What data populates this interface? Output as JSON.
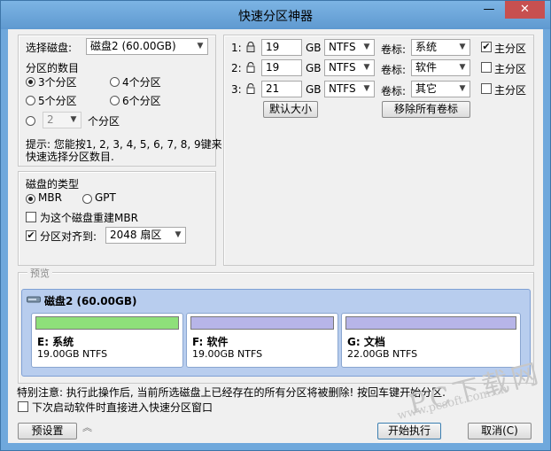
{
  "window": {
    "title": "快速分区神器",
    "minimize": "—",
    "close": "✕"
  },
  "disk": {
    "select_label": "选择磁盘:",
    "selected_disk": "磁盘2 (60.00GB)",
    "count_label": "分区的数目",
    "options": [
      "3个分区",
      "4个分区",
      "5个分区",
      "6个分区"
    ],
    "custom_value": "2",
    "custom_suffix": "个分区",
    "hint_line1": "提示: 您能按1, 2, 3, 4, 5, 6, 7, 8, 9键来",
    "hint_line2": "快速选择分区数目."
  },
  "disk_type": {
    "label": "磁盘的类型",
    "mbr": "MBR",
    "gpt": "GPT",
    "rebuild_mbr": "为这个磁盘重建MBR",
    "align_label": "分区对齐到:",
    "align_value": "2048 扇区"
  },
  "partitions": [
    {
      "index": "1:",
      "size": "19",
      "unit": "GB",
      "fs": "NTFS",
      "vol_label": "卷标:",
      "vol": "系统",
      "primary": "主分区",
      "primary_checked": true
    },
    {
      "index": "2:",
      "size": "19",
      "unit": "GB",
      "fs": "NTFS",
      "vol_label": "卷标:",
      "vol": "软件",
      "primary": "主分区",
      "primary_checked": false
    },
    {
      "index": "3:",
      "size": "21",
      "unit": "GB",
      "fs": "NTFS",
      "vol_label": "卷标:",
      "vol": "其它",
      "primary": "主分区",
      "primary_checked": false
    }
  ],
  "actions": {
    "default_size": "默认大小",
    "remove_labels": "移除所有卷标"
  },
  "preview": {
    "legend": "预览",
    "disk_title": "磁盘2 (60.00GB)",
    "parts": [
      {
        "name": "E: 系统",
        "size": "19.00GB NTFS",
        "color": "#8ee07a"
      },
      {
        "name": "F: 软件",
        "size": "19.00GB NTFS",
        "color": "#b7b5e8"
      },
      {
        "name": "G: 文档",
        "size": "22.00GB NTFS",
        "color": "#b7b5e8"
      }
    ]
  },
  "footer": {
    "warning": "特别注意: 执行此操作后, 当前所选磁盘上已经存在的所有分区将被删除! 按回车键开始分区.",
    "next_time": "下次启动软件时直接进入快速分区窗口",
    "preset": "预设置",
    "execute": "开始执行",
    "cancel": "取消(C)"
  },
  "watermark": {
    "big": "PC下载网",
    "url": "www.pcsoft.com.cn"
  },
  "colors": {
    "title_bar": "#6fa8dc",
    "close": "#c75050",
    "preview_bg": "#b8cdee"
  }
}
